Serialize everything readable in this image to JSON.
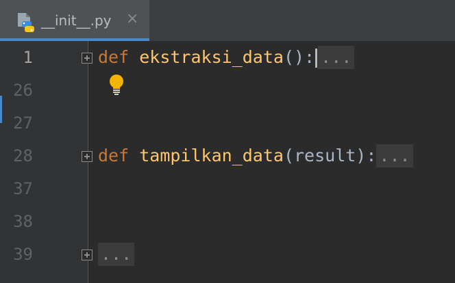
{
  "tab": {
    "filename": "__init__.py",
    "close_glyph": "×"
  },
  "gutter": {
    "line_numbers": [
      "1",
      "26",
      "27",
      "28",
      "37",
      "38",
      "39"
    ]
  },
  "code": {
    "line1": {
      "keyword": "def",
      "function": "ekstraksi_data",
      "params": "()",
      "colon": ":",
      "folded": "..."
    },
    "line2": {
      "keyword": "def",
      "function": "tampilkan_data",
      "params": "(result)",
      "colon": ":",
      "folded": "..."
    },
    "line3": {
      "folded": "..."
    }
  },
  "colors": {
    "background": "#2b2b2b",
    "keyword": "#cc7832",
    "function": "#ffc66d",
    "tab_accent": "#4a88c7",
    "bulb": "#f4b400"
  },
  "icons": {
    "tab": "python-file-icon",
    "bulb": "lightbulb-icon",
    "fold": "expand-fold-icon"
  }
}
